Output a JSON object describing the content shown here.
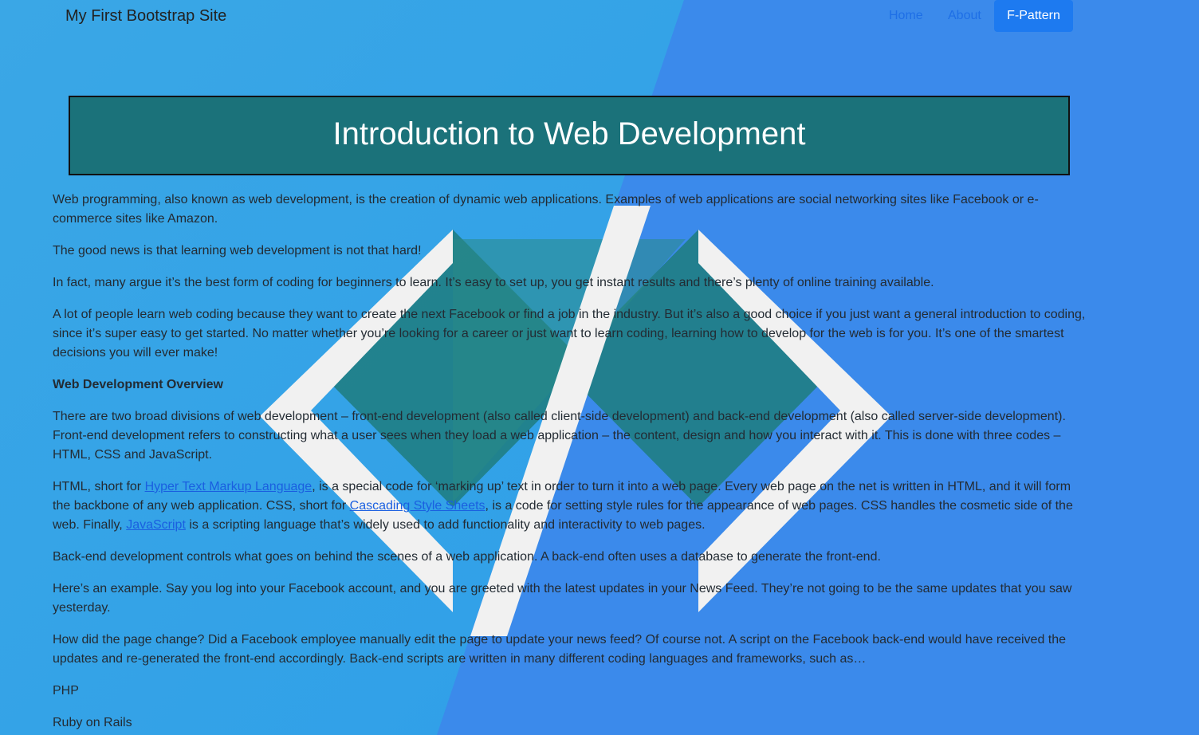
{
  "navbar": {
    "brand": "My First Bootstrap Site",
    "links": [
      {
        "label": "Home"
      },
      {
        "label": "About"
      },
      {
        "label": "F-Pattern"
      }
    ]
  },
  "title": "Introduction to Web Development",
  "paragraphs": {
    "p1": "Web programming, also known as web development, is the creation of dynamic web applications. Examples of web applications are social networking sites like Facebook or e-commerce sites like Amazon.",
    "p2": "The good news is that learning web development is not that hard!",
    "p3": "In fact, many argue it’s the best form of coding for beginners to learn. It’s easy to set up, you get instant results and there’s plenty of online training available.",
    "p4": "A lot of people learn web coding because they want to create the next Facebook or find a job in the industry. But it’s also a good choice if you just want a general introduction to coding, since it’s super easy to get started. No matter whether you’re looking for a career or just want to learn coding, learning how to develop for the web is for you. It’s one of the smartest decisions you will ever make!",
    "heading": "Web Development Overview",
    "p5": "There are two broad divisions of web development – front-end development (also called client-side development) and back-end development (also called server-side development). Front-end development refers to constructing what a user sees when they load a web application – the content, design and how you interact with it. This is done with three codes – HTML, CSS and JavaScript.",
    "p6": {
      "t1": "HTML, short for ",
      "link1": "Hyper Text Markup Language",
      "t2": ", is a special code for ‘marking up’ text in order to turn it into a web page. Every web page on the net is written in HTML, and it will form the backbone of any web application. CSS, short for ",
      "link2": " Cascading Style Sheets",
      "t3": ", is a code for setting style rules for the appearance of web pages. CSS handles the cosmetic side of the web. Finally, ",
      "link3": "JavaScript",
      "t4": " is a scripting language that’s widely used to add functionality and interactivity to web pages."
    },
    "p7": "Back-end development controls what goes on behind the scenes of a web application. A back-end often uses a database to generate the front-end.",
    "p8": "Here’s an example. Say you log into your Facebook account, and you are greeted with the latest updates in your News Feed. They’re not going to be the same updates that you saw yesterday.",
    "p9": "How did the page change? Did a Facebook employee manually edit the page to update your news feed? Of course not. A script on the Facebook back-end would have received the updates and re-generated the front-end accordingly. Back-end scripts are written in many different coding languages and frameworks, such as…",
    "p10": "PHP",
    "p11": "Ruby on Rails"
  },
  "colors": {
    "background": "#3b8fe8",
    "title_bg": "#1b727a",
    "active_nav": "#1d7af0",
    "link": "#1a5fe0"
  },
  "background_icon": "code-brackets-icon"
}
